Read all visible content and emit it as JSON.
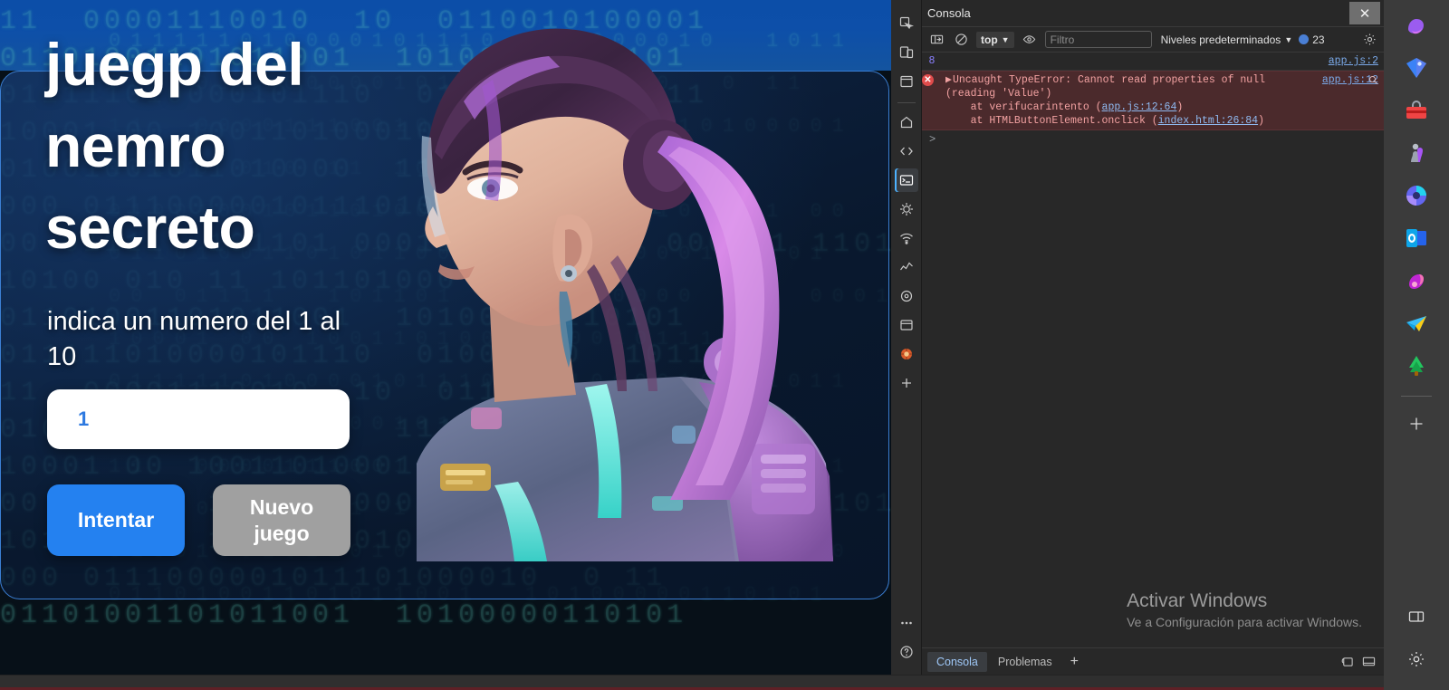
{
  "page": {
    "title": "juegp del nemro secreto",
    "prompt": "indica un numero del 1 al 10",
    "input_value": "1",
    "input_placeholder": "1",
    "button_try": "Intentar",
    "button_new": "Nuevo juego",
    "accent_blue": "#2481f0",
    "accent_grey": "#a0a0a0",
    "card_border": "#3b7fd4",
    "binary_line_1": "11  00001110010  10  0110010100001",
    "binary_line_2": "01101001101011001  10100000110101",
    "binary_line_3": "011111010000101110  01000010  1011",
    "binary_line_4": "10001 00 10011010001000101110 1",
    "binary_line_5": "01001001011010000  11111110  11 00",
    "binary_line_6": "000 0111000001011101000010  0 11",
    "binary_line_7": "00 01111  101101 0001100000 110 000101 11011",
    "binary_line_8": "10100 010 11 101101000 1"
  },
  "devtools": {
    "window_title": "Consola",
    "close_label": "✕",
    "toolbar": {
      "context": "top",
      "filter_placeholder": "Filtro",
      "levels_label": "Niveles predeterminados",
      "message_count": "23"
    },
    "messages": [
      {
        "kind": "log",
        "gutter": "8",
        "text": "",
        "source": "app.js:2"
      },
      {
        "kind": "error",
        "gutter": "",
        "text": "Uncaught TypeError: Cannot read properties of null (reading 'Value')",
        "stack": [
          {
            "prefix": "    at verifucarintento (",
            "link": "app.js:12:64",
            "suffix": ")"
          },
          {
            "prefix": "    at HTMLButtonElement.onclick (",
            "link": "index.html:26:84",
            "suffix": ")"
          }
        ],
        "source": "app.js:12"
      }
    ],
    "input_caret": ">",
    "footer_tabs": [
      {
        "label": "Consola",
        "selected": true
      },
      {
        "label": "Problemas",
        "selected": false
      }
    ],
    "footer_add": "+",
    "rail_items": [
      {
        "name": "inspect-element-icon",
        "selected": false
      },
      {
        "name": "device-toolbar-icon",
        "selected": false
      },
      {
        "name": "application-panel-icon",
        "selected": false
      },
      {
        "name": "home-icon",
        "selected": false
      },
      {
        "name": "elements-code-icon",
        "selected": false
      },
      {
        "name": "console-panel-icon",
        "selected": true
      },
      {
        "name": "sources-debug-icon",
        "selected": false
      },
      {
        "name": "network-icon",
        "selected": false
      },
      {
        "name": "performance-icon",
        "selected": false
      },
      {
        "name": "memory-icon",
        "selected": false
      },
      {
        "name": "storage-icon",
        "selected": false
      },
      {
        "name": "lighthouse-icon",
        "selected": false
      },
      {
        "name": "add-panel-icon",
        "selected": false
      }
    ],
    "rail_bottom": [
      {
        "name": "more-tools-icon"
      },
      {
        "name": "help-icon"
      }
    ]
  },
  "watermark": {
    "title": "Activar Windows",
    "subtitle": "Ve a Configuración para activar Windows."
  },
  "app_rail": {
    "items": [
      {
        "name": "copilot-app-icon",
        "color1": "#8b5cf6",
        "color2": "#d946ef"
      },
      {
        "name": "shopping-tag-app-icon",
        "color1": "#3b82f6",
        "color2": "#6366f1"
      },
      {
        "name": "toolbox-app-icon",
        "color1": "#ef4444",
        "color2": "#f97316"
      },
      {
        "name": "games-app-icon",
        "color1": "#9ca3af",
        "color2": "#a855f7"
      },
      {
        "name": "microsoft-365-app-icon",
        "color1": "#6366f1",
        "color2": "#22d3ee"
      },
      {
        "name": "outlook-app-icon",
        "color1": "#0ea5e9",
        "color2": "#1d4ed8"
      },
      {
        "name": "media-app-icon",
        "color1": "#c026d3",
        "color2": "#f472b6"
      },
      {
        "name": "telegram-app-icon",
        "color1": "#38bdf8",
        "color2": "#facc15"
      },
      {
        "name": "tree-app-icon",
        "color1": "#22c55e",
        "color2": "#15803d"
      }
    ],
    "add_label": "+",
    "bottom": [
      {
        "name": "split-screen-icon"
      },
      {
        "name": "settings-gear-icon"
      }
    ]
  }
}
